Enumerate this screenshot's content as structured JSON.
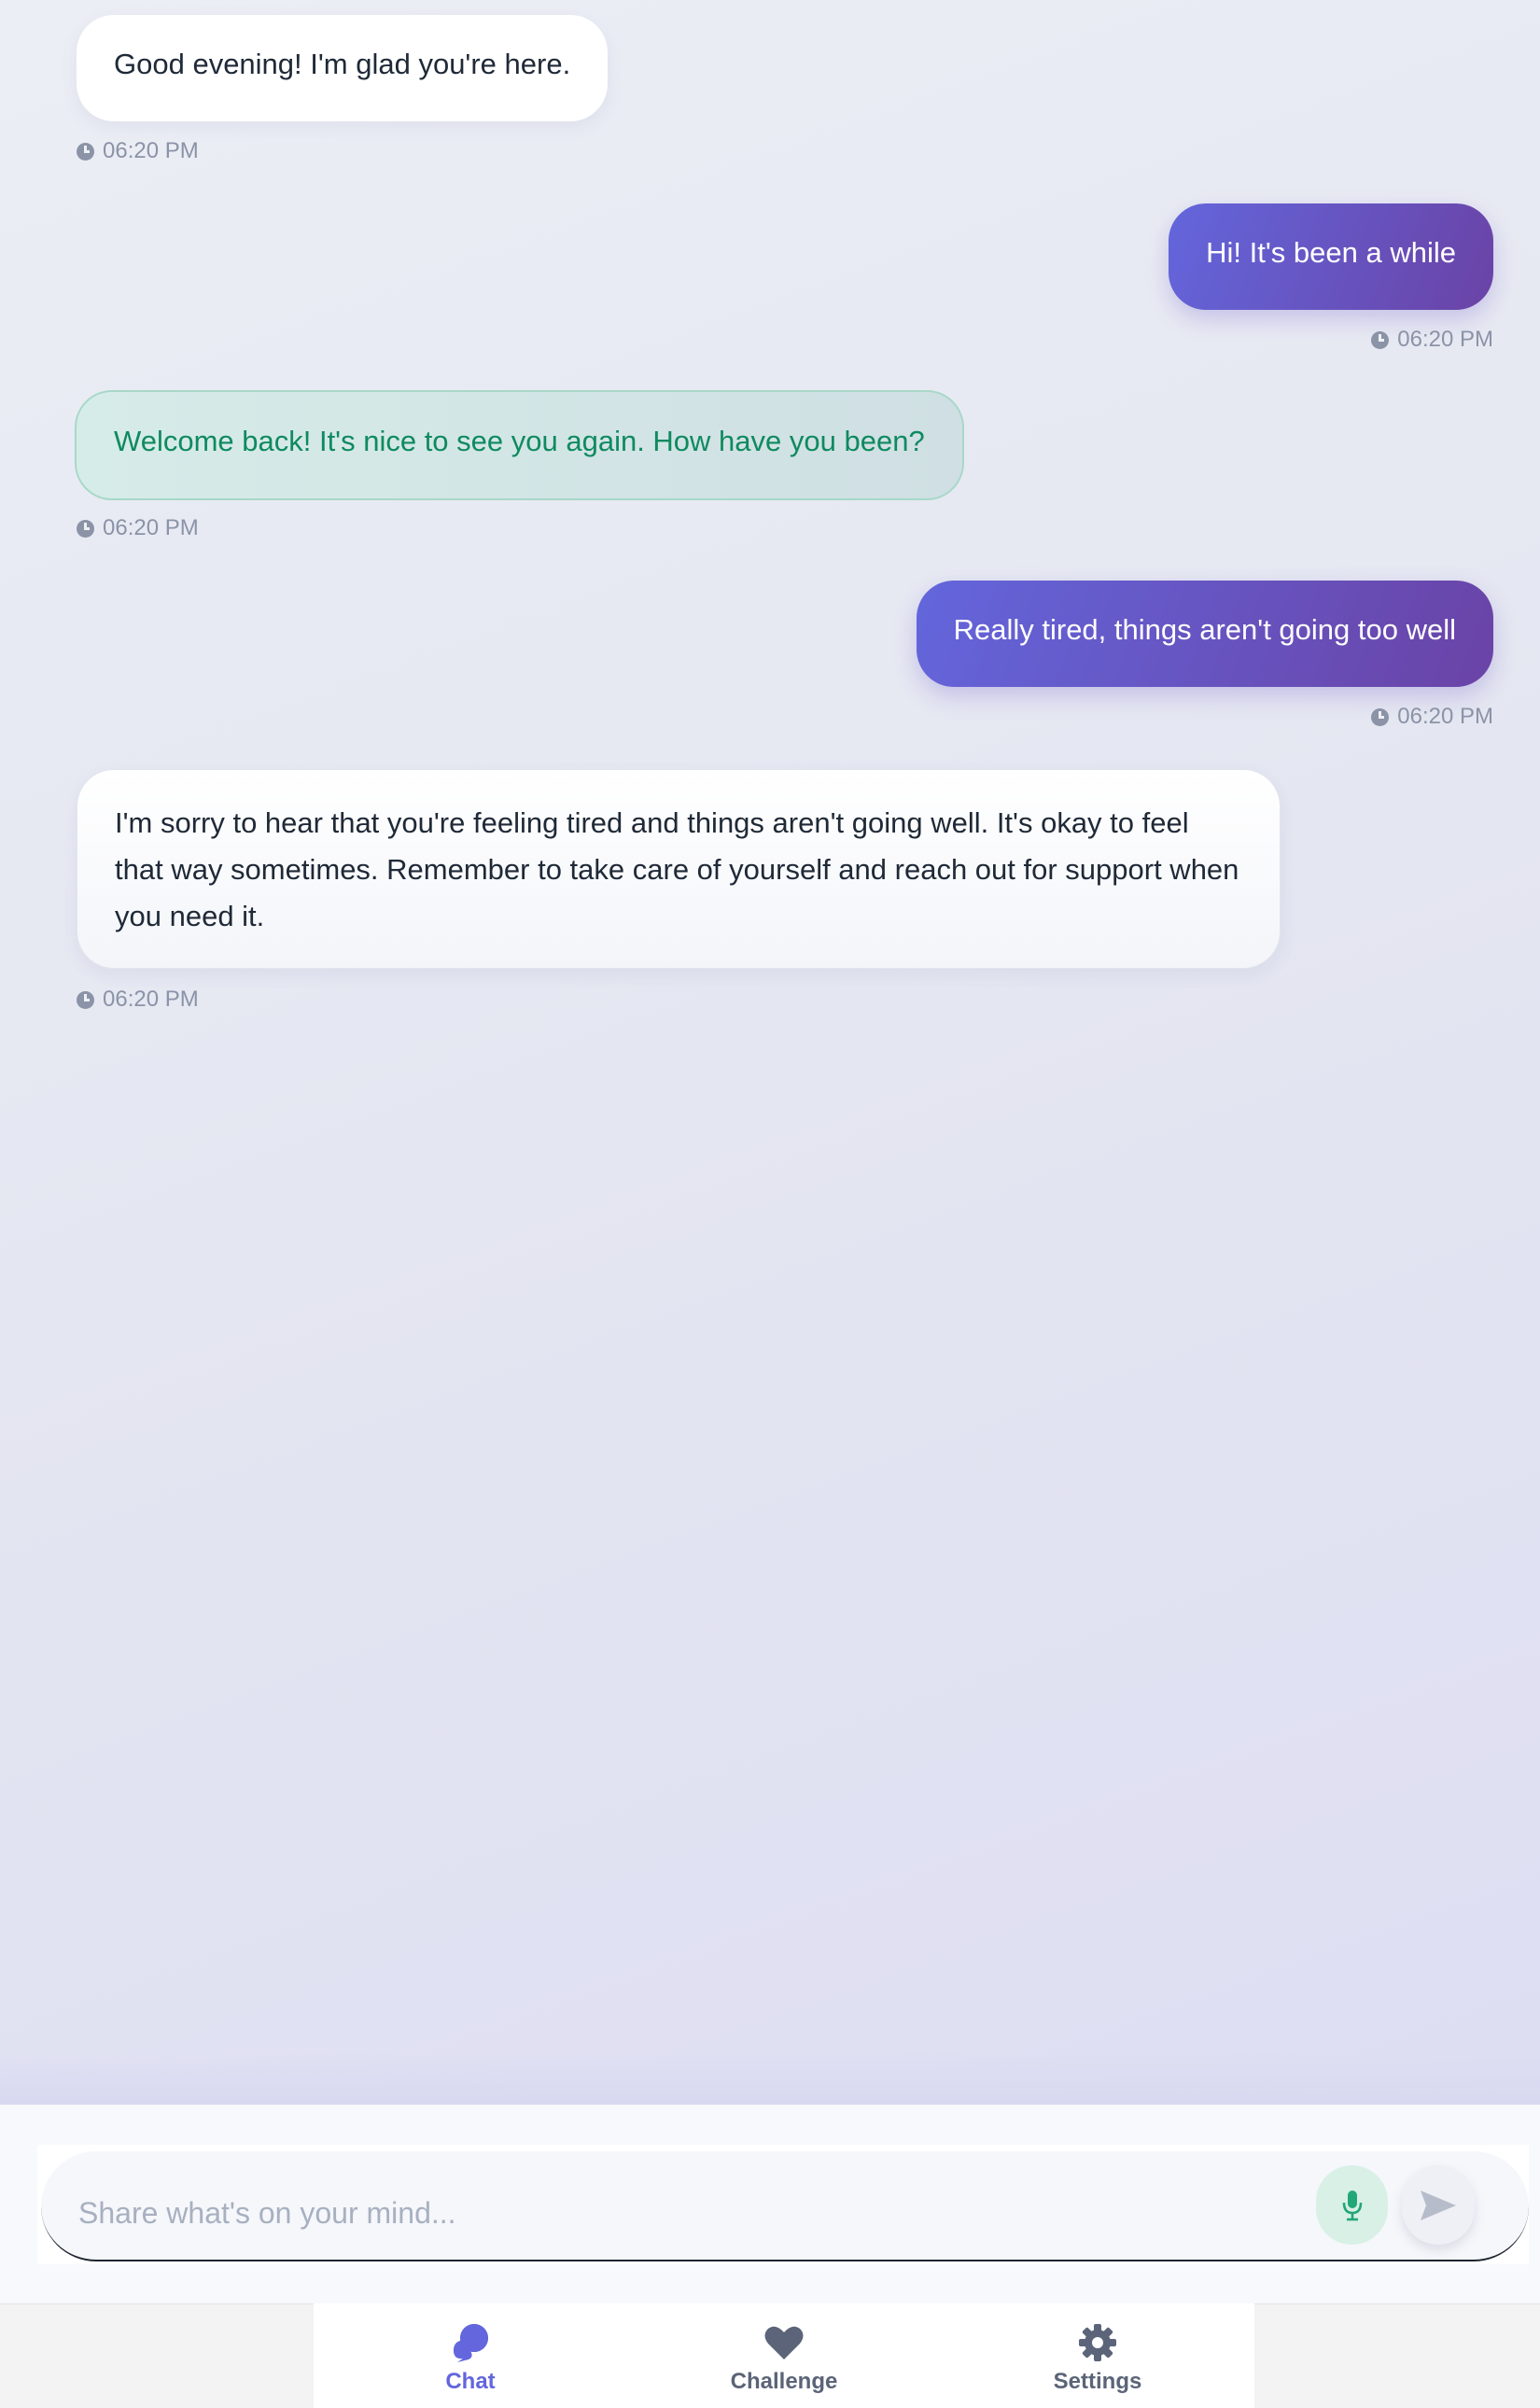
{
  "messages": [
    {
      "sender": "bot",
      "text": "Good evening! I'm glad you're here.",
      "time": "06:20 PM"
    },
    {
      "sender": "user",
      "text": "Hi! It's been a while",
      "time": "06:20 PM"
    },
    {
      "sender": "bot",
      "text": "Welcome back! It's nice to see you again. How have you been?",
      "time": "06:20 PM"
    },
    {
      "sender": "user",
      "text": "Really tired, things aren't going too well",
      "time": "06:20 PM"
    },
    {
      "sender": "bot",
      "text": "I'm sorry to hear that you're feeling tired and things aren't going well. It's okay to feel that way sometimes. Remember to take care of yourself and reach out for support when you need it.",
      "time": "06:20 PM"
    }
  ],
  "composer": {
    "placeholder": "Share what's on your mind...",
    "value": "",
    "mic_icon": "microphone-icon",
    "send_icon": "send-icon"
  },
  "nav": {
    "items": [
      {
        "label": "Chat",
        "icon": "chat-bubbles-icon",
        "active": true
      },
      {
        "label": "Challenge",
        "icon": "heart-icon",
        "active": false
      },
      {
        "label": "Settings",
        "icon": "gear-icon",
        "active": false
      }
    ]
  },
  "colors": {
    "accent": "#6366dc",
    "user_bubble_end": "#6a43a6",
    "bot_highlight_text": "#0f8a5f",
    "timestamp": "#8b93a7",
    "nav_inactive": "#5b6478"
  }
}
